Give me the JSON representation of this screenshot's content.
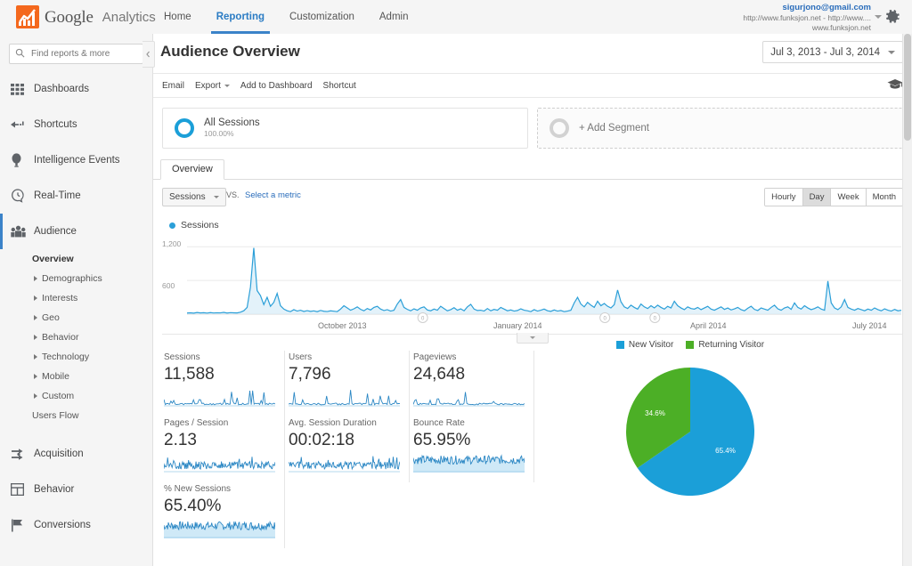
{
  "brand": {
    "logo_icon": "google-analytics-logo-icon",
    "word_google": "Google",
    "word_analytics": "Analytics"
  },
  "topnav": {
    "items": [
      {
        "label": "Home",
        "active": false
      },
      {
        "label": "Reporting",
        "active": true
      },
      {
        "label": "Customization",
        "active": false
      },
      {
        "label": "Admin",
        "active": false
      }
    ]
  },
  "account": {
    "email": "sigurjono@gmail.com",
    "property": "http://www.funksjon.net - http://www....",
    "domain": "www.funksjon.net",
    "caret_icon": "chevron-down-icon",
    "settings_icon": "gear-icon"
  },
  "sidebar": {
    "search": {
      "placeholder": "Find reports & more",
      "icon": "search-icon"
    },
    "items": [
      {
        "label": "Dashboards",
        "icon": "grid-icon",
        "selected": false
      },
      {
        "label": "Shortcuts",
        "icon": "arrow-left-dashed-icon",
        "selected": false
      },
      {
        "label": "Intelligence Events",
        "icon": "lightbulb-icon",
        "selected": false
      },
      {
        "label": "Real-Time",
        "icon": "clock-icon",
        "selected": false
      },
      {
        "label": "Audience",
        "icon": "people-icon",
        "selected": true
      }
    ],
    "audience_sub": [
      {
        "label": "Overview",
        "current": true,
        "expandable": false
      },
      {
        "label": "Demographics",
        "current": false,
        "expandable": true
      },
      {
        "label": "Interests",
        "current": false,
        "expandable": true
      },
      {
        "label": "Geo",
        "current": false,
        "expandable": true
      },
      {
        "label": "Behavior",
        "current": false,
        "expandable": true
      },
      {
        "label": "Technology",
        "current": false,
        "expandable": true
      },
      {
        "label": "Mobile",
        "current": false,
        "expandable": true
      },
      {
        "label": "Custom",
        "current": false,
        "expandable": true
      },
      {
        "label": "Users Flow",
        "current": false,
        "expandable": false
      }
    ],
    "bottom_items": [
      {
        "label": "Acquisition",
        "icon": "acquisition-arrows-icon"
      },
      {
        "label": "Behavior",
        "icon": "layout-icon"
      },
      {
        "label": "Conversions",
        "icon": "flag-icon"
      }
    ]
  },
  "page": {
    "title": "Audience Overview",
    "date_range": "Jul 3, 2013 - Jul 3, 2014",
    "date_caret_icon": "chevron-down-icon"
  },
  "toolbar": {
    "email": "Email",
    "export": "Export",
    "add_to_dashboard": "Add to Dashboard",
    "shortcut": "Shortcut",
    "help_icon": "graduation-cap-icon"
  },
  "segments": {
    "all_sessions_label": "All Sessions",
    "all_sessions_pct": "100.00%",
    "add_segment_label": "+ Add Segment"
  },
  "tabs": [
    {
      "label": "Overview",
      "active": true
    }
  ],
  "chart_controls": {
    "metric_select": "Sessions",
    "vs_label": "VS.",
    "select_metric": "Select a metric",
    "granularity": [
      {
        "label": "Hourly",
        "selected": false
      },
      {
        "label": "Day",
        "selected": true
      },
      {
        "label": "Week",
        "selected": false
      },
      {
        "label": "Month",
        "selected": false
      }
    ]
  },
  "chart_data": [
    {
      "type": "line",
      "title": "Sessions",
      "legend": [
        "Sessions"
      ],
      "legend_position": "top-left",
      "series_color": "#2b9fd8",
      "xlabel": "",
      "ylabel": "",
      "ylim": [
        0,
        1300
      ],
      "yticks": [
        600,
        1200
      ],
      "ytick_labels": [
        "600",
        "1,200"
      ],
      "xticks": [
        "October 2013",
        "January 2014",
        "April 2014",
        "July 2014"
      ],
      "grid": true,
      "x": [
        "Jul 3, 2013",
        "Jul 3, 2014"
      ],
      "values": [
        20,
        24,
        18,
        30,
        22,
        26,
        19,
        28,
        21,
        25,
        23,
        31,
        20,
        27,
        24,
        22,
        35,
        60,
        120,
        480,
        1180,
        420,
        330,
        170,
        300,
        140,
        210,
        370,
        150,
        90,
        60,
        45,
        80,
        55,
        70,
        48,
        62,
        50,
        58,
        44,
        66,
        52,
        47,
        59,
        53,
        45,
        90,
        150,
        110,
        70,
        95,
        130,
        85,
        60,
        100,
        75,
        120,
        140,
        90,
        65,
        80,
        55,
        70,
        180,
        260,
        120,
        85,
        60,
        95,
        70,
        110,
        130,
        75,
        60,
        90,
        70,
        140,
        100,
        60,
        80,
        115,
        70,
        95,
        60,
        130,
        175,
        90,
        65,
        70,
        55,
        100,
        60,
        85,
        70,
        120,
        90,
        60,
        75,
        55,
        65,
        95,
        70,
        60,
        45,
        80,
        55,
        70,
        90,
        60,
        50,
        75,
        55,
        65,
        45,
        55,
        70,
        200,
        300,
        180,
        130,
        210,
        160,
        120,
        230,
        150,
        190,
        140,
        110,
        170,
        430,
        220,
        130,
        100,
        160,
        120,
        90,
        180,
        130,
        100,
        150,
        110,
        160,
        120,
        90,
        140,
        110,
        230,
        150,
        110,
        80,
        130,
        100,
        90,
        120,
        80,
        110,
        140,
        90,
        70,
        100,
        130,
        85,
        110,
        75,
        95,
        120,
        80,
        60,
        105,
        140,
        85,
        65,
        110,
        90,
        70,
        120,
        160,
        95,
        70,
        110,
        130,
        85,
        200,
        120,
        90,
        150,
        110,
        80,
        100,
        130,
        90,
        70,
        590,
        200,
        110,
        80,
        130,
        260,
        120,
        90,
        70,
        100,
        80,
        60,
        90,
        70,
        110,
        80,
        60,
        95,
        70,
        55,
        85,
        60,
        70
      ],
      "annotations": [
        "annotation-marker-1",
        "annotation-marker-2",
        "annotation-marker-3"
      ]
    },
    {
      "type": "pie",
      "title": "New vs Returning",
      "labels": [
        "New Visitor",
        "Returning Visitor"
      ],
      "values": [
        65.4,
        34.6
      ],
      "value_labels": [
        "65.4%",
        "34.6%"
      ],
      "colors": [
        "#1b9fd8",
        "#4caf26"
      ],
      "legend_position": "top"
    }
  ],
  "metrics": [
    {
      "label": "Sessions",
      "value": "11,588",
      "spark": "spiky"
    },
    {
      "label": "Users",
      "value": "7,796",
      "spark": "spiky"
    },
    {
      "label": "Pageviews",
      "value": "24,648",
      "spark": "spiky"
    },
    {
      "label": "Pages / Session",
      "value": "2.13",
      "spark": "dense"
    },
    {
      "label": "Avg. Session Duration",
      "value": "00:02:18",
      "spark": "dense"
    },
    {
      "label": "Bounce Rate",
      "value": "65.95%",
      "spark": "filled"
    },
    {
      "label": "% New Sessions",
      "value": "65.40%",
      "spark": "filled"
    }
  ],
  "colors": {
    "accent_blue": "#2b9fd8",
    "link_blue": "#2a6dbb",
    "green": "#4caf26",
    "logo_orange": "#f4681d"
  }
}
